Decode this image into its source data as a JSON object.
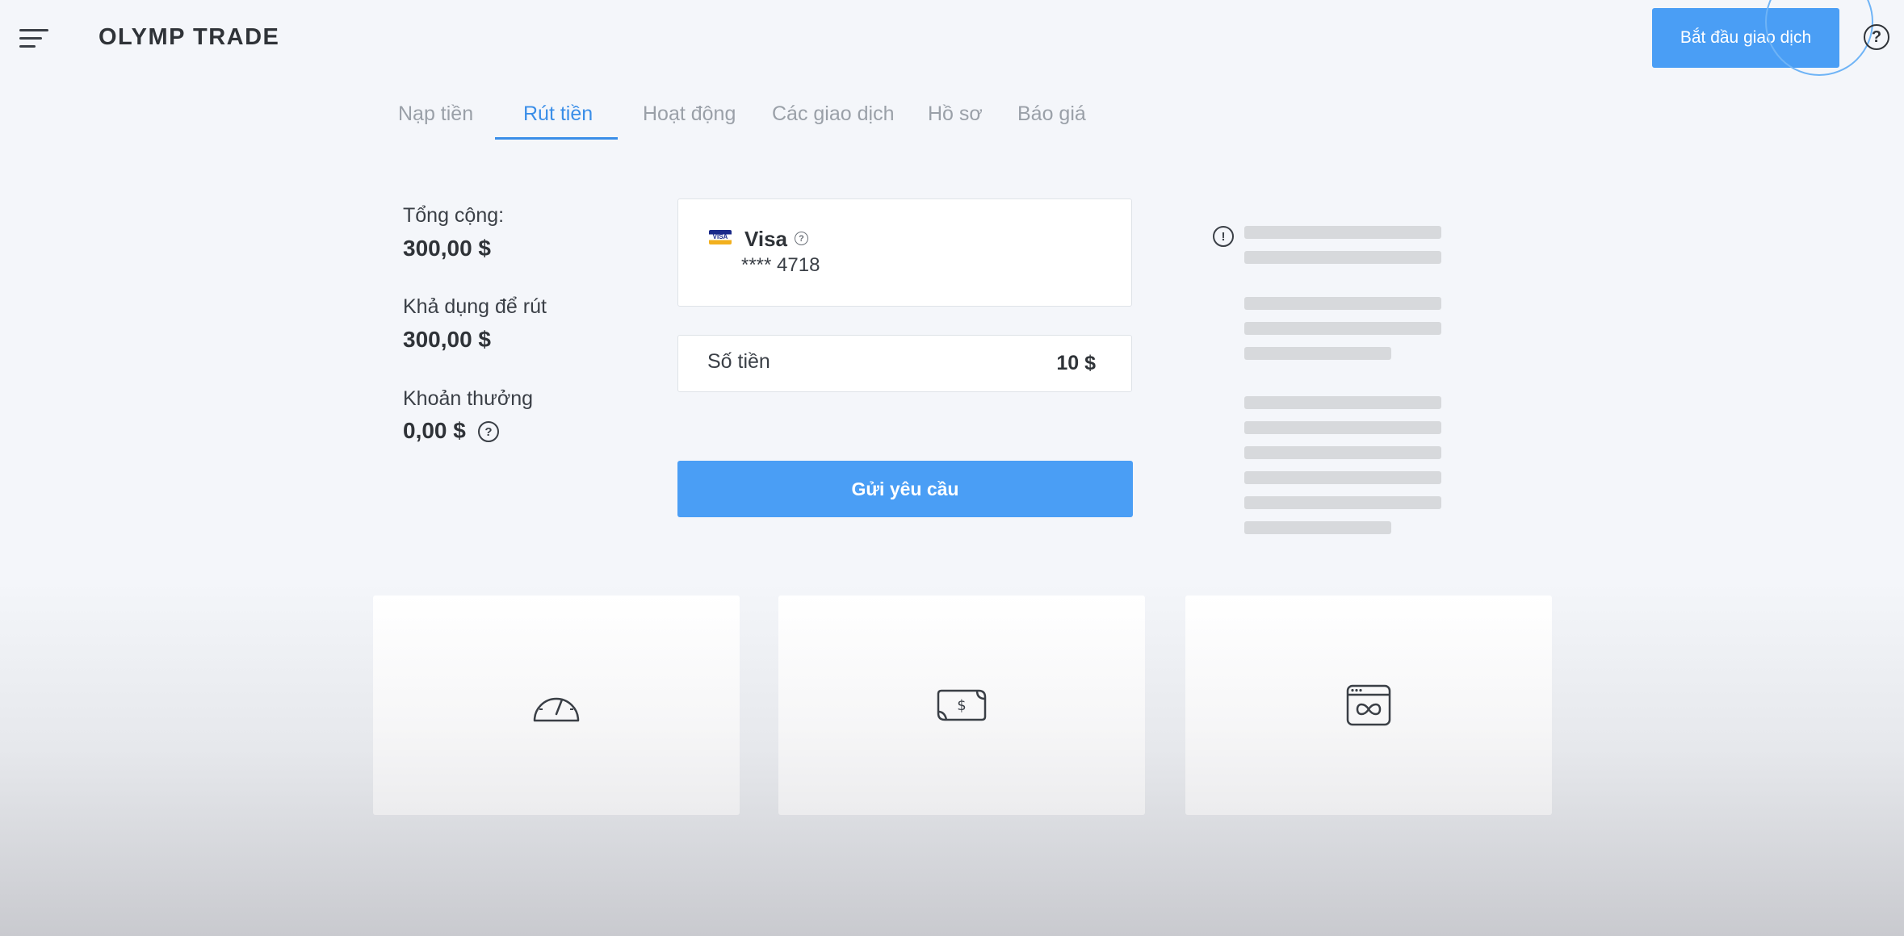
{
  "header": {
    "logo_text": "OLYMP TRADE",
    "start_trading_label": "Bắt đầu giao dịch",
    "help_label": "?"
  },
  "tabs": [
    {
      "label": "Nạp tiền",
      "active": false
    },
    {
      "label": "Rút tiền",
      "active": true
    },
    {
      "label": "Hoạt động",
      "active": false
    },
    {
      "label": "Các giao dịch",
      "active": false
    },
    {
      "label": "Hồ sơ",
      "active": false
    },
    {
      "label": "Báo giá",
      "active": false
    }
  ],
  "balance": {
    "total_label": "Tổng cộng:",
    "total_value": "300,00 $",
    "available_label": "Khả dụng để rút",
    "available_value": "300,00 $",
    "bonus_label": "Khoản thưởng",
    "bonus_value": "0,00 $"
  },
  "card": {
    "brand": "Visa",
    "brand_mini": "VISA",
    "number": "**** 4718"
  },
  "amount": {
    "label": "Số tiền",
    "value": "10 $"
  },
  "submit_label": "Gửi yêu cầu",
  "features": [
    {
      "icon": "speedometer-icon"
    },
    {
      "icon": "money-bill-icon"
    },
    {
      "icon": "infinity-card-icon"
    }
  ],
  "colors": {
    "accent": "#4a9ef5",
    "active_tab": "#3a8ee8",
    "skeleton": "#d7d9dc"
  }
}
